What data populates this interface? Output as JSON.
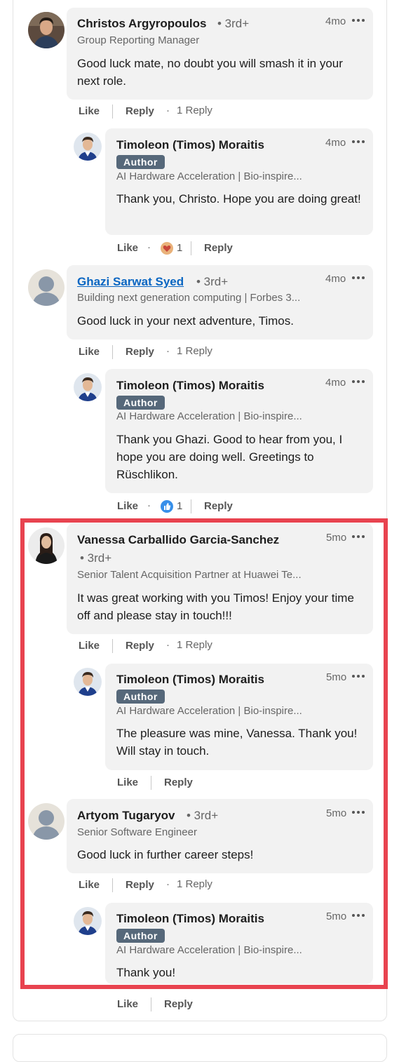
{
  "labels": {
    "like": "Like",
    "reply": "Reply",
    "author_badge": "Author",
    "dot": "·"
  },
  "comments": [
    {
      "name": "Christos Argyropoulos",
      "degree": "• 3rd+",
      "headline": "Group Reporting Manager",
      "time": "4mo",
      "text": "Good luck mate, no doubt you will smash it in your next role.",
      "replies_label": "1 Reply",
      "reply": {
        "name": "Timoleon (Timos) Moraitis",
        "headline": "AI Hardware Acceleration | Bio-inspire...",
        "time": "4mo",
        "text": "Thank you, Christo. Hope you are doing great!",
        "reaction": "heart-reaction",
        "reaction_count": "1"
      }
    },
    {
      "name": "Ghazi Sarwat Syed",
      "degree": "• 3rd+",
      "headline": "Building next generation computing | Forbes 3...",
      "time": "4mo",
      "text": "Good luck in your next adventure, Timos.",
      "replies_label": "1 Reply",
      "reply": {
        "name": "Timoleon (Timos) Moraitis",
        "headline": "AI Hardware Acceleration | Bio-inspire...",
        "time": "4mo",
        "text": "Thank you Ghazi. Good to hear from you, I hope you are doing well. Greetings to Rüschlikon.",
        "reaction": "like-reaction",
        "reaction_count": "1"
      }
    },
    {
      "name": "Vanessa Carballido Garcia-Sanchez",
      "degree": "• 3rd+",
      "headline": "Senior Talent Acquisition Partner at Huawei Te...",
      "time": "5mo",
      "text": "It was great working with you Timos! Enjoy your time off and please stay in touch!!!",
      "replies_label": "1 Reply",
      "reply": {
        "name": "Timoleon (Timos) Moraitis",
        "headline": "AI Hardware Acceleration | Bio-inspire...",
        "time": "5mo",
        "text": "The pleasure was mine, Vanessa. Thank you! Will stay in touch."
      }
    },
    {
      "name": "Artyom Tugaryov",
      "degree": "• 3rd+",
      "headline": "Senior Software Engineer",
      "time": "5mo",
      "text": "Good luck in further career steps!",
      "replies_label": "1 Reply",
      "reply": {
        "name": "Timoleon (Timos) Moraitis",
        "headline": "AI Hardware Acceleration | Bio-inspire...",
        "time": "5mo",
        "text": "Thank you!"
      }
    }
  ],
  "colors": {
    "highlight": "#e8434f",
    "author_badge": "#56687a",
    "link": "#0a66c2",
    "bubble": "#f2f2f2"
  }
}
